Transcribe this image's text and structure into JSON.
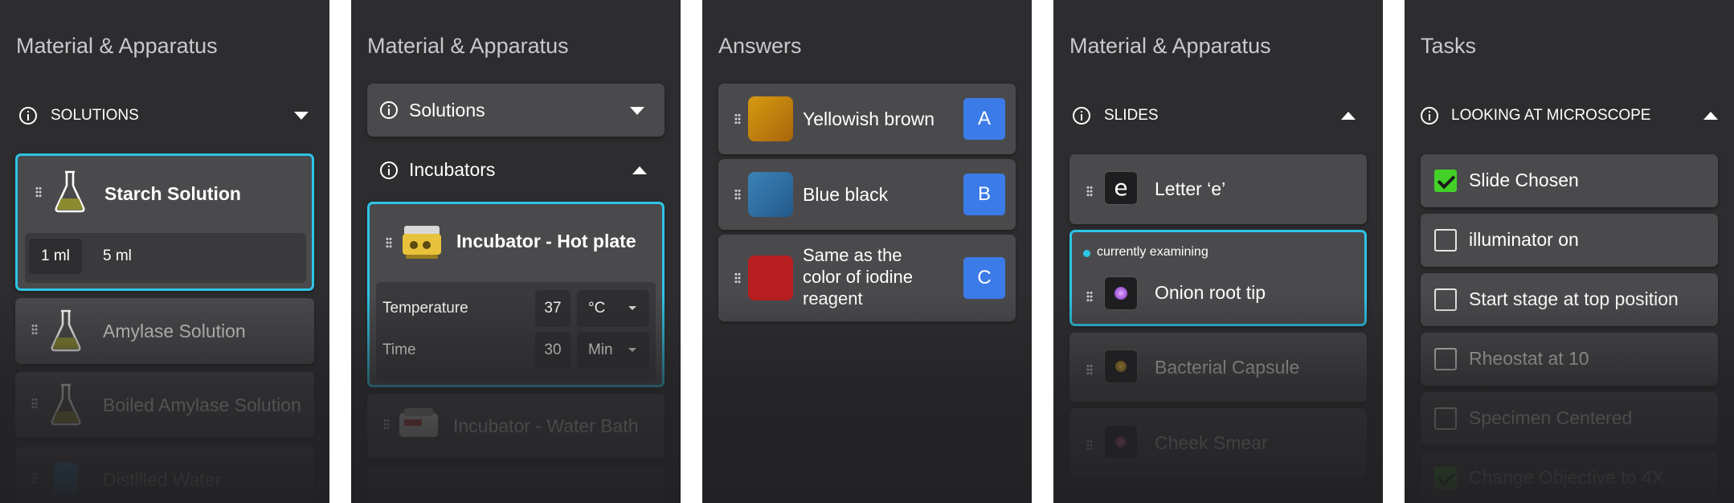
{
  "panel1": {
    "title": "Material & Apparatus",
    "section": "SOLUTIONS",
    "items": [
      {
        "label": "Starch Solution",
        "volumes": [
          "1 ml",
          "5 ml"
        ]
      },
      {
        "label": "Amylase Solution"
      },
      {
        "label": "Boiled Amylase Solution"
      },
      {
        "label": "Distilled Water"
      }
    ]
  },
  "panel2": {
    "title": "Material & Apparatus",
    "sections": [
      "Solutions",
      "Incubators"
    ],
    "selected": {
      "label": "Incubator - Hot plate",
      "temperature_label": "Temperature",
      "temperature_value": "37",
      "temperature_unit": "°C",
      "time_label": "Time",
      "time_value": "30",
      "time_unit": "Min"
    },
    "next_item": "Incubator - Water Bath"
  },
  "panel3": {
    "title": "Answers",
    "answers": [
      {
        "text": "Yellowish brown",
        "letter": "A",
        "color": "#c8860e"
      },
      {
        "text": "Blue black",
        "letter": "B",
        "color": "#2f6da3"
      },
      {
        "text_lines": [
          "Same as the",
          "color of iodine",
          "reagent"
        ],
        "letter": "C",
        "color": "#b91f20"
      }
    ],
    "accent": "#3b7be8"
  },
  "panel4": {
    "title": "Material & Apparatus",
    "section": "SLIDES",
    "items": [
      {
        "label": "Letter ‘e’",
        "thumb_glyph": "e"
      },
      {
        "label": "Onion root tip",
        "status": "currently examining"
      },
      {
        "label": "Bacterial Capsule"
      },
      {
        "label": "Cheek Smear"
      }
    ]
  },
  "panel5": {
    "title": "Tasks",
    "section": "LOOKING AT MICROSCOPE",
    "tasks": [
      {
        "label": "Slide Chosen",
        "checked": true
      },
      {
        "label": "illuminator on",
        "checked": false
      },
      {
        "label": "Start stage at top position",
        "checked": false
      },
      {
        "label": "Rheostat at 10",
        "checked": false
      },
      {
        "label": "Specimen Centered",
        "checked": false
      },
      {
        "label": "Change Objective to 4X",
        "checked": true
      }
    ]
  },
  "colors": {
    "selection": "#2ec4e6",
    "panel_bg": "#2d2d2f",
    "card_bg": "#4a4a4d",
    "check_green": "#43d128"
  }
}
